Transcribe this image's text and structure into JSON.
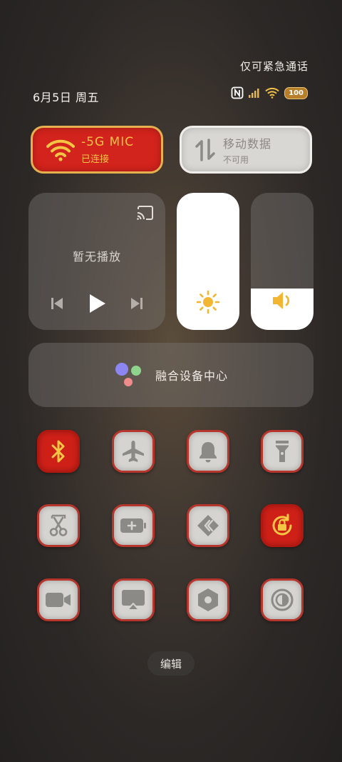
{
  "status_bar": {
    "emergency_text": "仅可紧急通话",
    "date_text": "6月5日 周五",
    "battery_text": "100",
    "icons": [
      "nfc-icon",
      "signal-icon",
      "wifi-icon",
      "battery-icon"
    ]
  },
  "tiles": {
    "wifi": {
      "title": "-5G   MIC",
      "status": "已连接",
      "active": true
    },
    "mobile_data": {
      "title": "移动数据",
      "status": "不可用",
      "active": false
    }
  },
  "media": {
    "now_playing": "暂无播放"
  },
  "sliders": {
    "brightness_level": 1.0,
    "volume_level": 0.3
  },
  "fusion": {
    "label": "融合设备中心"
  },
  "toggles": [
    {
      "name": "bluetooth",
      "icon": "bluetooth-icon",
      "active": true
    },
    {
      "name": "airplane",
      "icon": "airplane-icon",
      "active": false
    },
    {
      "name": "notification",
      "icon": "bell-icon",
      "active": false
    },
    {
      "name": "flashlight",
      "icon": "flashlight-icon",
      "active": false
    },
    {
      "name": "screenshot",
      "icon": "scissors-icon",
      "active": false
    },
    {
      "name": "power-saving",
      "icon": "battery-plus-icon",
      "active": false
    },
    {
      "name": "share",
      "icon": "share-icon",
      "active": false
    },
    {
      "name": "rotation-lock",
      "icon": "rotation-lock-icon",
      "active": true
    },
    {
      "name": "screen-record",
      "icon": "video-camera-icon",
      "active": false
    },
    {
      "name": "screen-cast",
      "icon": "screen-cast-icon",
      "active": false
    },
    {
      "name": "settings",
      "icon": "hexagon-nut-icon",
      "active": false
    },
    {
      "name": "dark-mode",
      "icon": "dark-mode-icon",
      "active": false
    }
  ],
  "edit_label": "编辑",
  "colors": {
    "active_red": "#cf2018",
    "active_gold": "#f6c544",
    "inactive_gray": "#d6d4d0",
    "icon_gray": "#8c8a87"
  }
}
